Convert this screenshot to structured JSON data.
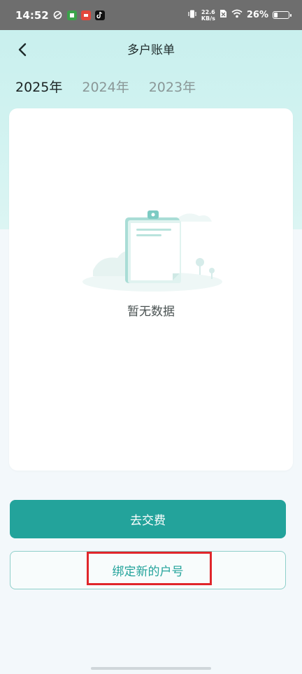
{
  "status_bar": {
    "time": "14:52",
    "net_speed_value": "22.6",
    "net_speed_unit": "KB/s",
    "battery_percent": "26%",
    "battery_level": 0.26
  },
  "header": {
    "title": "多户账单"
  },
  "year_tabs": [
    {
      "label": "2025年",
      "active": true
    },
    {
      "label": "2024年",
      "active": false
    },
    {
      "label": "2023年",
      "active": false
    }
  ],
  "empty_state": {
    "icon": "empty-clipboard-illustration",
    "text": "暂无数据"
  },
  "actions": {
    "pay_label": "去交费",
    "bind_label": "绑定新的户号"
  },
  "colors": {
    "accent": "#23a39b",
    "highlight": "#e0262b",
    "hero_bg": "#d3f3f1"
  }
}
